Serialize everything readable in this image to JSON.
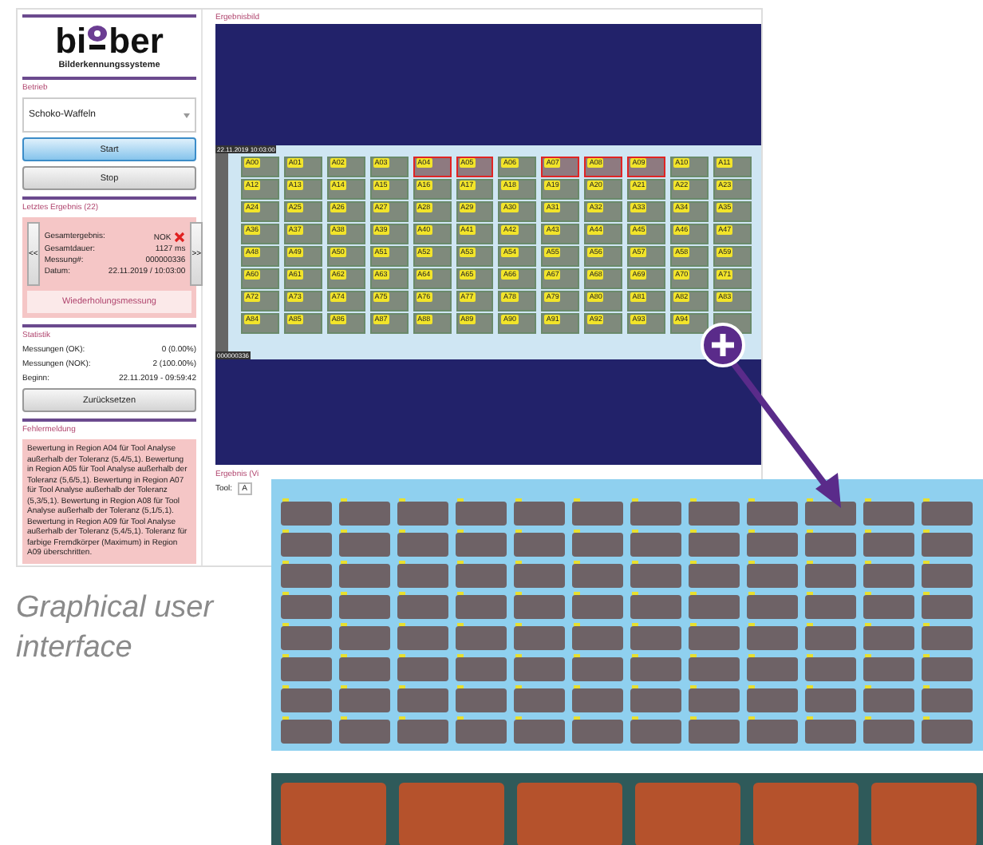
{
  "logo": {
    "name_start": "bi",
    "name_end": "ber",
    "tagline": "Bilderkennungssysteme"
  },
  "operation": {
    "title": "Betrieb",
    "program": "Schoko-Waffeln",
    "buttons": [
      {
        "label": "Start",
        "highlighted": true
      },
      {
        "label": "Stop",
        "highlighted": false
      }
    ]
  },
  "last_result": {
    "title": "Letztes Ergebnis (22)",
    "prev": "<<",
    "next": ">>",
    "rows": [
      {
        "label": "Gesamtergebnis:",
        "value": "NOK",
        "failed": true
      },
      {
        "label": "Gesamtdauer:",
        "value": "1127 ms",
        "failed": false
      },
      {
        "label": "Messung#:",
        "value": "000000336",
        "failed": false
      },
      {
        "label": "Datum:",
        "value": "22.11.2019 / 10:03:00",
        "failed": false
      }
    ],
    "repeat_button": "Wiederholungsmessung"
  },
  "statistics": {
    "title": "Statistik",
    "rows": [
      {
        "label": "Messungen (OK):",
        "value": "0 (0.00%)"
      },
      {
        "label": "Messungen (NOK):",
        "value": "2 (100.00%)"
      },
      {
        "label": "Beginn:",
        "value": "22.11.2019 - 09:59:42"
      }
    ],
    "reset_button": "Zurücksetzen"
  },
  "error": {
    "title": "Fehlermeldung",
    "message": "Bewertung in Region A04 für Tool Analyse außerhalb der Toleranz (5,4/5,1). Bewertung in Region A05 für Tool Analyse außerhalb der Toleranz (5,6/5,1). Bewertung in Region A07 für Tool Analyse außerhalb der Toleranz (5,3/5,1). Bewertung in Region A08 für Tool Analyse außerhalb der Toleranz (5,1/5,1). Bewertung in Region A09 für Tool Analyse außerhalb der Toleranz (5,4/5,1). Toleranz für farbige Fremdkörper (Maximum) in Region A09 überschritten."
  },
  "result_image": {
    "title": "Ergebnisbild",
    "timestamp": "22.11.2019 10:03:00",
    "counter": "000000336",
    "cells": [
      {
        "label": "A00",
        "defect": false
      },
      {
        "label": "A01",
        "defect": false
      },
      {
        "label": "A02",
        "defect": false
      },
      {
        "label": "A03",
        "defect": false
      },
      {
        "label": "A04",
        "defect": true
      },
      {
        "label": "A05",
        "defect": true
      },
      {
        "label": "A06",
        "defect": false
      },
      {
        "label": "A07",
        "defect": true
      },
      {
        "label": "A08",
        "defect": true
      },
      {
        "label": "A09",
        "defect": true
      },
      {
        "label": "A10",
        "defect": false
      },
      {
        "label": "A11",
        "defect": false
      },
      {
        "label": "A12",
        "defect": false
      },
      {
        "label": "A13",
        "defect": false
      },
      {
        "label": "A14",
        "defect": false
      },
      {
        "label": "A15",
        "defect": false
      },
      {
        "label": "A16",
        "defect": false
      },
      {
        "label": "A17",
        "defect": false
      },
      {
        "label": "A18",
        "defect": false
      },
      {
        "label": "A19",
        "defect": false
      },
      {
        "label": "A20",
        "defect": false
      },
      {
        "label": "A21",
        "defect": false
      },
      {
        "label": "A22",
        "defect": false
      },
      {
        "label": "A23",
        "defect": false
      },
      {
        "label": "A24",
        "defect": false
      },
      {
        "label": "A25",
        "defect": false
      },
      {
        "label": "A26",
        "defect": false
      },
      {
        "label": "A27",
        "defect": false
      },
      {
        "label": "A28",
        "defect": false
      },
      {
        "label": "A29",
        "defect": false
      },
      {
        "label": "A30",
        "defect": false
      },
      {
        "label": "A31",
        "defect": false
      },
      {
        "label": "A32",
        "defect": false
      },
      {
        "label": "A33",
        "defect": false
      },
      {
        "label": "A34",
        "defect": false
      },
      {
        "label": "A35",
        "defect": false
      },
      {
        "label": "A36",
        "defect": false
      },
      {
        "label": "A37",
        "defect": false
      },
      {
        "label": "A38",
        "defect": false
      },
      {
        "label": "A39",
        "defect": false
      },
      {
        "label": "A40",
        "defect": false
      },
      {
        "label": "A41",
        "defect": false
      },
      {
        "label": "A42",
        "defect": false
      },
      {
        "label": "A43",
        "defect": false
      },
      {
        "label": "A44",
        "defect": false
      },
      {
        "label": "A45",
        "defect": false
      },
      {
        "label": "A46",
        "defect": false
      },
      {
        "label": "A47",
        "defect": false
      },
      {
        "label": "A48",
        "defect": false
      },
      {
        "label": "A49",
        "defect": false
      },
      {
        "label": "A50",
        "defect": false
      },
      {
        "label": "A51",
        "defect": false
      },
      {
        "label": "A52",
        "defect": false
      },
      {
        "label": "A53",
        "defect": false
      },
      {
        "label": "A54",
        "defect": false
      },
      {
        "label": "A55",
        "defect": false
      },
      {
        "label": "A56",
        "defect": false
      },
      {
        "label": "A57",
        "defect": false
      },
      {
        "label": "A58",
        "defect": false
      },
      {
        "label": "A59",
        "defect": false
      },
      {
        "label": "A60",
        "defect": false
      },
      {
        "label": "A61",
        "defect": false
      },
      {
        "label": "A62",
        "defect": false
      },
      {
        "label": "A63",
        "defect": false
      },
      {
        "label": "A64",
        "defect": false
      },
      {
        "label": "A65",
        "defect": false
      },
      {
        "label": "A66",
        "defect": false
      },
      {
        "label": "A67",
        "defect": false
      },
      {
        "label": "A68",
        "defect": false
      },
      {
        "label": "A69",
        "defect": false
      },
      {
        "label": "A70",
        "defect": false
      },
      {
        "label": "A71",
        "defect": false
      },
      {
        "label": "A72",
        "defect": false
      },
      {
        "label": "A73",
        "defect": false
      },
      {
        "label": "A74",
        "defect": false
      },
      {
        "label": "A75",
        "defect": false
      },
      {
        "label": "A76",
        "defect": false
      },
      {
        "label": "A77",
        "defect": false
      },
      {
        "label": "A78",
        "defect": false
      },
      {
        "label": "A79",
        "defect": false
      },
      {
        "label": "A80",
        "defect": false
      },
      {
        "label": "A81",
        "defect": false
      },
      {
        "label": "A82",
        "defect": false
      },
      {
        "label": "A83",
        "defect": false
      },
      {
        "label": "A84",
        "defect": false
      },
      {
        "label": "A85",
        "defect": false
      },
      {
        "label": "A86",
        "defect": false
      },
      {
        "label": "A87",
        "defect": false
      },
      {
        "label": "A88",
        "defect": false
      },
      {
        "label": "A89",
        "defect": false
      },
      {
        "label": "A90",
        "defect": false
      },
      {
        "label": "A91",
        "defect": false
      },
      {
        "label": "A92",
        "defect": false
      },
      {
        "label": "A93",
        "defect": false
      },
      {
        "label": "A94",
        "defect": false
      },
      {
        "defect": false
      }
    ]
  },
  "result_table": {
    "title": "Ergebnis (Vi",
    "tool_label": "Tool:",
    "tool_value": "A"
  },
  "caption": "Graphical user interface"
}
